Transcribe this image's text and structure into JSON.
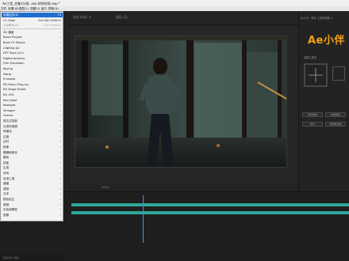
{
  "window": {
    "title": "Ae工程_合集1分镜 .aep 转转样照.aep *"
  },
  "menubar": {
    "items": [
      {
        "label": "文件"
      },
      {
        "label": "效果(W)"
      },
      {
        "label": "图层(L)"
      },
      {
        "label": "视图(V)"
      },
      {
        "label": "窗口"
      },
      {
        "label": "帮助(H)"
      }
    ]
  },
  "effects_menu": {
    "items": [
      {
        "label": "效果控件(E)",
        "shortcut": "F3",
        "highlighted": true
      },
      {
        "label": "CC Glow",
        "shortcut": "Ctrl+Alt+Shift+E"
      },
      {
        "label": "全部移除(R)",
        "shortcut": "Ctrl+Shift+E",
        "dim": true
      },
      {
        "label": "3D 通道",
        "submenu": true
      },
      {
        "label": "Blace Plugins",
        "submenu": true
      },
      {
        "label": "Boris FX Mocha",
        "submenu": true
      },
      {
        "label": "CINEMA 4D",
        "submenu": true
      },
      {
        "label": "DFT Rays v2.0",
        "submenu": true
      },
      {
        "label": "Digital Anarchy",
        "submenu": true
      },
      {
        "label": "Film Emulation",
        "submenu": true
      },
      {
        "label": "Keying",
        "submenu": true
      },
      {
        "label": "Matte",
        "submenu": true
      },
      {
        "label": "Primatte",
        "submenu": true
      },
      {
        "label": "RE:Vision Plug-ins",
        "submenu": true
      },
      {
        "label": "RG Magic Bullet",
        "submenu": true
      },
      {
        "label": "RG VFX",
        "submenu": true
      },
      {
        "label": "Red Giant",
        "submenu": true
      },
      {
        "label": "Rowbyte",
        "submenu": true
      },
      {
        "label": "Vimager",
        "submenu": true
      },
      {
        "label": "Vranzo",
        "submenu": true
      },
      {
        "label": "表达式控制",
        "submenu": true
      },
      {
        "label": "沉浸式视频",
        "submenu": true
      },
      {
        "label": "风格化",
        "submenu": true
      },
      {
        "label": "过渡",
        "submenu": true
      },
      {
        "label": "过时",
        "submenu": true
      },
      {
        "label": "抠像",
        "submenu": true
      },
      {
        "label": "模糊和锐化",
        "submenu": true
      },
      {
        "label": "模拟",
        "submenu": true
      },
      {
        "label": "扭曲",
        "submenu": true
      },
      {
        "label": "生成",
        "submenu": true
      },
      {
        "label": "时间",
        "submenu": true
      },
      {
        "label": "实用工具",
        "submenu": true
      },
      {
        "label": "通道",
        "submenu": true
      },
      {
        "label": "透视",
        "submenu": true
      },
      {
        "label": "文本",
        "submenu": true
      },
      {
        "label": "颜色校正",
        "submenu": true
      },
      {
        "label": "音频",
        "submenu": true
      },
      {
        "label": "杂色和颗粒",
        "submenu": true
      },
      {
        "label": "遮罩",
        "submenu": true
      }
    ]
  },
  "viewer": {
    "tabs": [
      {
        "label": "合成 合成1 ≡"
      },
      {
        "label": "图层 (无)"
      }
    ],
    "zoom": "100%"
  },
  "right_panel": {
    "header": "Ae小伴 · 脚本 工程管理器 ≡",
    "brand": "Ae小伴",
    "section": "剪辑工具包",
    "buttons": [
      {
        "label": "剪切素材"
      },
      {
        "label": "合成预设"
      },
      {
        "label": "标记"
      },
      {
        "label": "添加至渲染"
      }
    ]
  },
  "status": {
    "text": "渲染时间 0毫秒"
  },
  "colors": {
    "accent": "#f6a21b",
    "menu_highlight": "#1e6fd0",
    "track": "#2fa89a"
  }
}
